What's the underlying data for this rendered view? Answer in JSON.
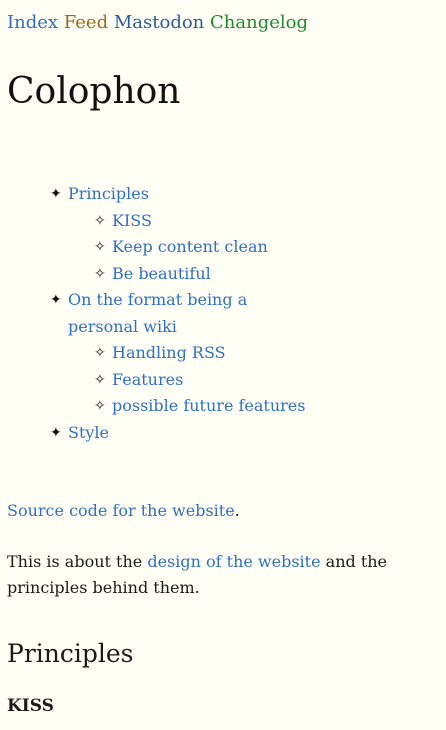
{
  "nav": {
    "index": "Index",
    "feed": "Feed",
    "mastodon": "Mastodon",
    "changelog": "Changelog",
    "colors": {
      "index": "#2f6fc4",
      "feed": "#9a6a14",
      "mastodon": "#2c5a9a",
      "changelog": "#1f8a2a"
    }
  },
  "page_title": "Colophon",
  "toc": {
    "bullet_main": "✦",
    "bullet_sub": "✧",
    "items": [
      {
        "label": "Principles",
        "children": [
          "KISS",
          "Keep content clean",
          "Be beautiful"
        ]
      },
      {
        "label": "On the format being a personal wiki",
        "children": [
          "Handling RSS",
          "Features",
          "possible future features"
        ]
      },
      {
        "label": "Style",
        "children": []
      }
    ]
  },
  "source": {
    "link": "Source code for the website",
    "after": "."
  },
  "intro": {
    "before": "This is about the ",
    "link": "design of the website",
    "after": " and the principles behind them."
  },
  "section_heading": "Principles",
  "subsection_heading": "KISS",
  "link_color": "#2f6fc4",
  "background_color": "#fffff6"
}
